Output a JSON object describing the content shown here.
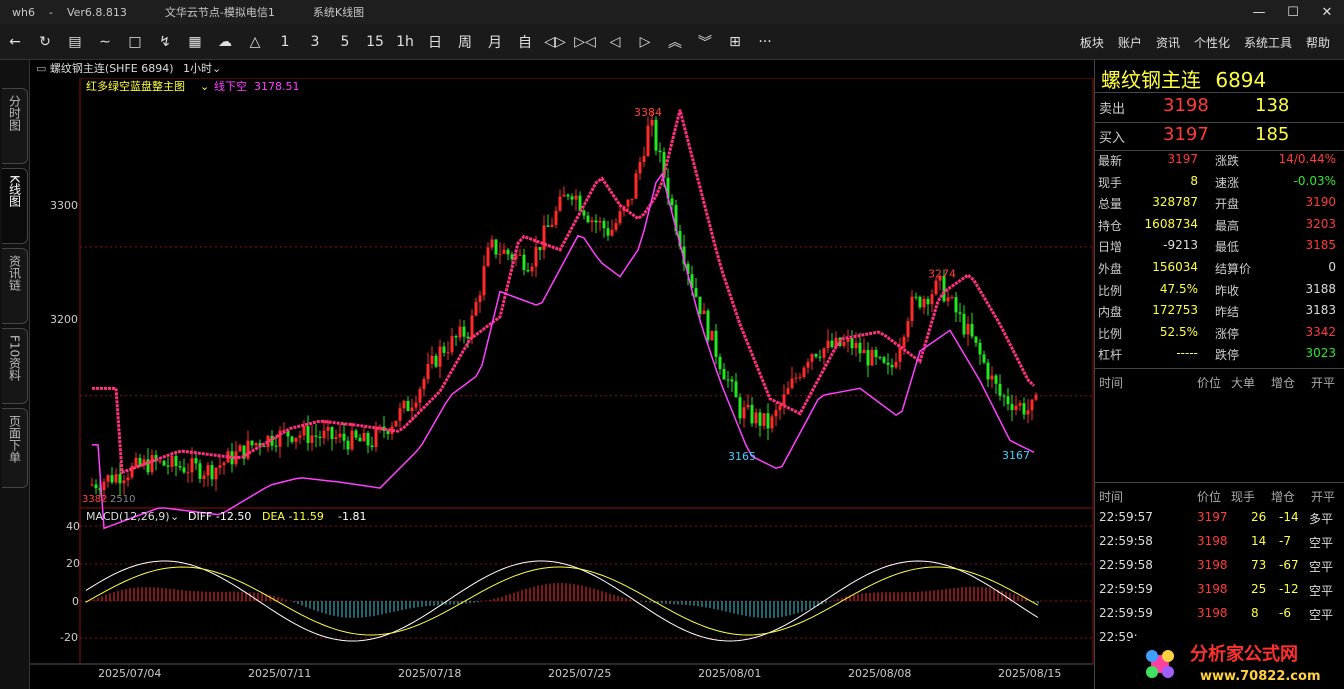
{
  "titlebar": {
    "app": "wh6",
    "ver": "Ver6.8.813",
    "node": "文华云节点-模拟电信1",
    "view": "系统K线图",
    "min": "—",
    "max": "☐",
    "close": "✕"
  },
  "toolbar": {
    "icons": [
      "back-icon",
      "refresh-icon",
      "list-icon",
      "line-chart-icon",
      "bar-chart-icon",
      "tick-chart-icon",
      "grid-icon",
      "cloud-icon",
      "bell-icon"
    ],
    "periods": [
      "1",
      "3",
      "5",
      "15",
      "1h",
      "日",
      "周",
      "月",
      "自"
    ],
    "tools": [
      "◁▷",
      "▷◁",
      "◁",
      "▷",
      "︽",
      "︾",
      "⊞",
      "···"
    ],
    "menu": [
      "板块",
      "账户",
      "资讯",
      "个性化",
      "系统工具",
      "帮助"
    ]
  },
  "sidetabs": [
    "分时图",
    "K线图",
    "资讯链",
    "F10资料",
    "页面下单"
  ],
  "chart": {
    "symbol": "螺纹钢主连(SHFE 6894)",
    "period": "1小时",
    "indicator": "红多绿空蓝盘整主图",
    "line_label": "线下空",
    "line_value": "3178.51",
    "high_label": "3384",
    "high2_label": "3274",
    "low_label": "3165",
    "low2_label": "3167",
    "bottom_left": "3382",
    "bottom_left2": "2510",
    "yticks": [
      "3300",
      "3200"
    ],
    "macd_label": "MACD(12,26,9)",
    "diff": "DIFF -12.50",
    "dea": "DEA -11.59",
    "macd": "-1.81",
    "macd_yticks": [
      "40",
      "20",
      "0",
      "-20"
    ],
    "xticks": [
      "2025/07/04",
      "2025/07/11",
      "2025/07/18",
      "2025/07/25",
      "2025/08/01",
      "2025/08/08",
      "2025/08/15"
    ]
  },
  "chart_data": {
    "type": "candlestick",
    "ylim": [
      3130,
      3400
    ],
    "yticks": [
      3300,
      3200
    ],
    "highs": [
      {
        "label": "3384",
        "value": 3384
      },
      {
        "label": "3274",
        "value": 3274
      }
    ],
    "lows": [
      {
        "label": "3165",
        "value": 3165
      },
      {
        "label": "3167",
        "value": 3167
      }
    ],
    "x": [
      "2025/07/04",
      "2025/07/11",
      "2025/07/18",
      "2025/07/25",
      "2025/08/01",
      "2025/08/08",
      "2025/08/15"
    ]
  },
  "quote": {
    "name": "螺纹钢主连",
    "code": "6894",
    "ask_label": "卖出",
    "ask_price": "3198",
    "ask_vol": "138",
    "bid_label": "买入",
    "bid_price": "3197",
    "bid_vol": "185",
    "left": [
      {
        "k": "最新",
        "v": "3197",
        "c": "red"
      },
      {
        "k": "现手",
        "v": "8",
        "c": "yel"
      },
      {
        "k": "总量",
        "v": "328787",
        "c": "yel"
      },
      {
        "k": "持仓",
        "v": "1608734",
        "c": "yel"
      },
      {
        "k": "日增",
        "v": "-9213",
        "c": "wht"
      },
      {
        "k": "外盘",
        "v": "156034",
        "c": "yel"
      },
      {
        "k": "比例",
        "v": "47.5%",
        "c": "yel"
      },
      {
        "k": "内盘",
        "v": "172753",
        "c": "yel"
      },
      {
        "k": "比例",
        "v": "52.5%",
        "c": "yel"
      },
      {
        "k": "杠杆",
        "v": "-----",
        "c": "yel"
      }
    ],
    "right": [
      {
        "k": "涨跌",
        "v": "14/0.44%",
        "c": "red"
      },
      {
        "k": "速涨",
        "v": "-0.03%",
        "c": "grn"
      },
      {
        "k": "开盘",
        "v": "3190",
        "c": "red"
      },
      {
        "k": "最高",
        "v": "3203",
        "c": "red"
      },
      {
        "k": "最低",
        "v": "3185",
        "c": "red"
      },
      {
        "k": "结算价",
        "v": "0",
        "c": "wht"
      },
      {
        "k": "昨收",
        "v": "3188",
        "c": "wht"
      },
      {
        "k": "昨结",
        "v": "3183",
        "c": "wht"
      },
      {
        "k": "涨停",
        "v": "3342",
        "c": "red"
      },
      {
        "k": "跌停",
        "v": "3023",
        "c": "grn"
      }
    ]
  },
  "header1": [
    "时间",
    "价位",
    "大单",
    "增仓",
    "开平"
  ],
  "header2": [
    "时间",
    "价位",
    "现手",
    "增仓",
    "开平"
  ],
  "ticks": [
    {
      "t": "22:59:57",
      "p": "3197",
      "v": "26",
      "z": "-14",
      "k": "多平"
    },
    {
      "t": "22:59:58",
      "p": "3198",
      "v": "14",
      "z": "-7",
      "k": "空平"
    },
    {
      "t": "22:59:58",
      "p": "3198",
      "v": "73",
      "z": "-67",
      "k": "空平"
    },
    {
      "t": "22:59:59",
      "p": "3198",
      "v": "25",
      "z": "-12",
      "k": "空平"
    },
    {
      "t": "22:59:59",
      "p": "3198",
      "v": "8",
      "z": "-6",
      "k": "空平"
    },
    {
      "t": "22:59:",
      "p": "",
      "v": "",
      "z": "",
      "k": ""
    }
  ],
  "logo": {
    "text": "分析家公式网",
    "url": "www.70822.com"
  },
  "colors": {
    "up": "#ff2a2a",
    "down": "#22e622",
    "consolidate": "#40c8ff",
    "grid": "#7a1010",
    "accent": "#ffff40"
  }
}
